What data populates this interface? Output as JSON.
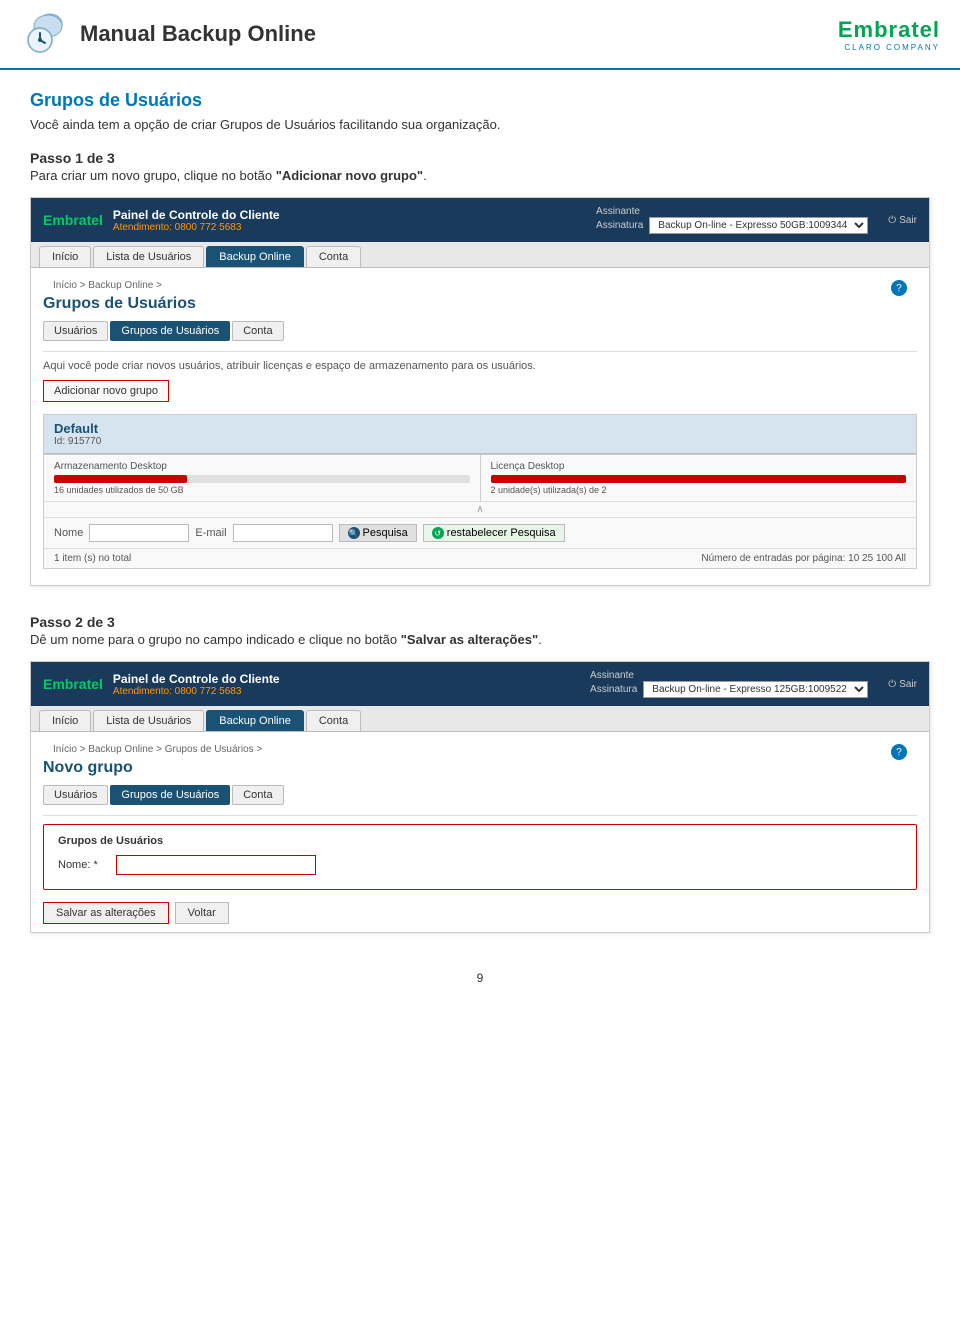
{
  "header": {
    "title": "Manual Backup Online",
    "logo": "Embratel",
    "logo_tagline": "CLARO COMPANY"
  },
  "section1": {
    "title": "Grupos de Usuários",
    "desc": "Você ainda tem a opção de criar Grupos de Usuários facilitando sua organização."
  },
  "step1": {
    "title": "Passo 1 de 3",
    "desc_start": "Para criar um novo grupo, clique no botão ",
    "desc_bold": "\"Adicionar novo grupo\"",
    "desc_end": "."
  },
  "step2": {
    "title": "Passo 2 de 3",
    "desc_start": "Dê um nome para o grupo no campo indicado e clique no botão ",
    "desc_bold": "\"Salvar as alterações\"",
    "desc_end": "."
  },
  "screenshot1": {
    "panel_title": "Painel de Controle do Cliente",
    "atendimento_label": "Atendimento:",
    "atendimento_phone": "0800 772 5683",
    "assinante_label": "Assinante",
    "assinatura_label": "Assinatura",
    "assinatura_value": "Backup On-line - Expresso 50GB:1009344",
    "sair_label": "Sair",
    "nav_items": [
      "Início",
      "Lista de Usuários",
      "Backup Online",
      "Conta"
    ],
    "nav_active": "Backup Online",
    "breadcrumb": "Início > Backup Online >",
    "page_title": "Grupos de Usuários",
    "subtabs": [
      "Usuários",
      "Grupos de Usuários",
      "Conta"
    ],
    "subtab_active": "Grupos de Usuários",
    "info_text": "Aqui você pode criar novos usuários, atribuir licenças e espaço de armazenamento para os usuários.",
    "add_button": "Adicionar novo grupo",
    "group": {
      "name": "Default",
      "id": "Id: 915770",
      "storage_label": "Armazenamento Desktop",
      "storage_text": "16 unidades utilizados de 50 GB",
      "storage_percent": 32,
      "license_label": "Licença Desktop",
      "license_text": "2 unidade(s) utilizada(s) de 2",
      "license_percent": 100
    },
    "search_nome_label": "Nome",
    "search_email_label": "E-mail",
    "search_btn": "Pesquisa",
    "restore_btn": "restabelecer Pesquisa",
    "pagination_left": "1 item (s) no total",
    "pagination_right": "Número de entradas por página:",
    "pagination_links": [
      "10",
      "25",
      "100",
      "All"
    ]
  },
  "screenshot2": {
    "panel_title": "Painel de Controle do Cliente",
    "atendimento_label": "Atendimento:",
    "atendimento_phone": "0800 772 5683",
    "assinante_label": "Assinante",
    "assinatura_label": "Assinatura",
    "assinatura_value": "Backup On-line - Expresso 125GB:1009522",
    "sair_label": "Sair",
    "nav_items": [
      "Início",
      "Lista de Usuários",
      "Backup Online",
      "Conta"
    ],
    "nav_active": "Backup Online",
    "breadcrumb": "Início > Backup Online > Grupos de Usuários >",
    "page_title": "Novo grupo",
    "subtabs": [
      "Usuários",
      "Grupos de Usuários",
      "Conta"
    ],
    "subtab_active": "Grupos de Usuários",
    "form_section_title": "Grupos de Usuários",
    "form_nome_label": "Nome: *",
    "form_nome_value": "",
    "save_btn": "Salvar as alterações",
    "back_btn": "Voltar"
  },
  "page_number": "9",
  "colors": {
    "blue_dark": "#1a3a5c",
    "blue_mid": "#1a5276",
    "blue_accent": "#0077b6",
    "green": "#00a651",
    "red": "#c00000",
    "orange": "#f90000"
  }
}
